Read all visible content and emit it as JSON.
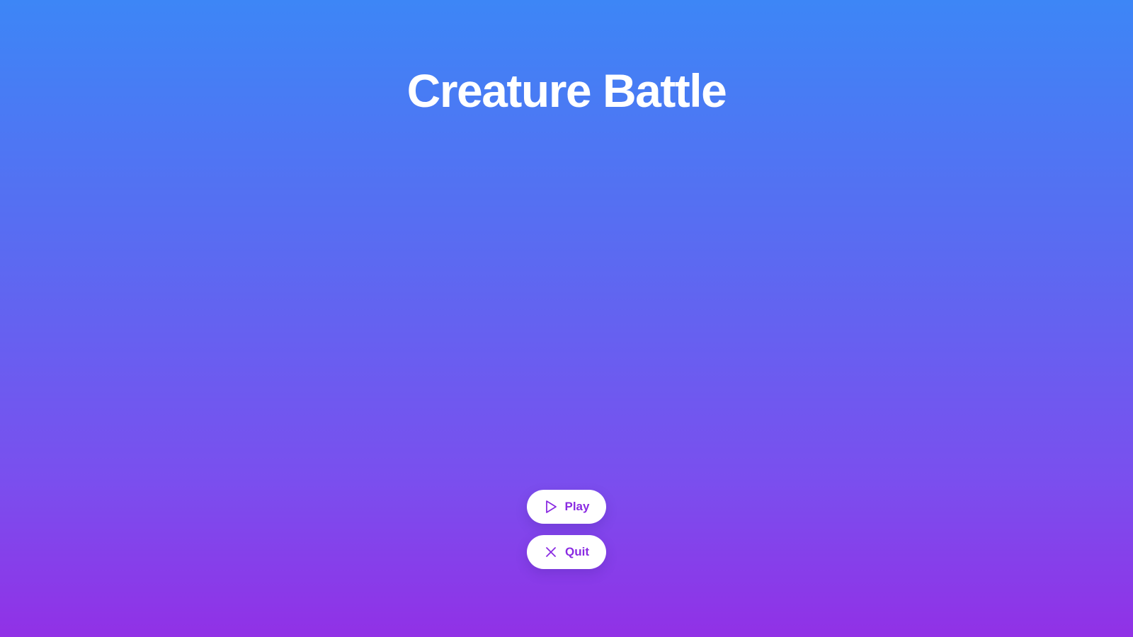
{
  "game": {
    "title": "Creature Battle"
  },
  "menu": {
    "play": {
      "label": "Play",
      "icon": "play-icon"
    },
    "quit": {
      "label": "Quit",
      "icon": "close-icon"
    }
  },
  "colors": {
    "gradient_top": "#3d86f6",
    "gradient_bottom": "#9131e6",
    "button_background": "#ffffff",
    "button_text": "#8a2be2",
    "title_text": "#ffffff"
  }
}
